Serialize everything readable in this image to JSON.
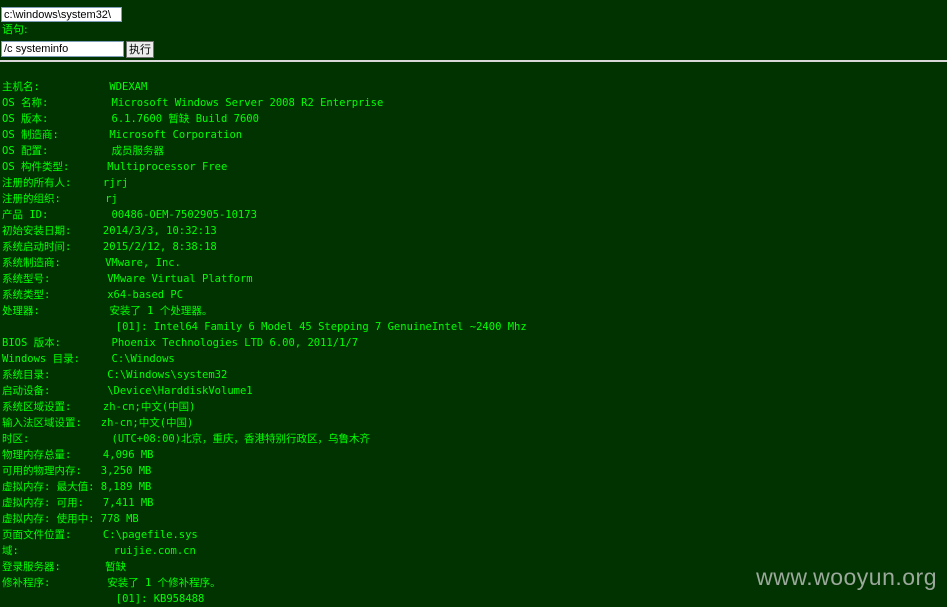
{
  "form": {
    "path_value": "c:\\windows\\system32\\",
    "statement_label": "语句:",
    "command_value": "/c systeminfo",
    "execute_label": "执行"
  },
  "output_lines": [
    "主机名:           WDEXAM",
    "OS 名称:          Microsoft Windows Server 2008 R2 Enterprise",
    "OS 版本:          6.1.7600 暂缺 Build 7600",
    "OS 制造商:        Microsoft Corporation",
    "OS 配置:          成员服务器",
    "OS 构件类型:      Multiprocessor Free",
    "注册的所有人:     rjrj",
    "注册的组织:       rj",
    "产品 ID:          00486-OEM-7502905-10173",
    "初始安装日期:     2014/3/3, 10:32:13",
    "系统启动时间:     2015/2/12, 8:38:18",
    "系统制造商:       VMware, Inc.",
    "系统型号:         VMware Virtual Platform",
    "系统类型:         x64-based PC",
    "处理器:           安装了 1 个处理器。",
    "                  [01]: Intel64 Family 6 Model 45 Stepping 7 GenuineIntel ~2400 Mhz",
    "BIOS 版本:        Phoenix Technologies LTD 6.00, 2011/1/7",
    "Windows 目录:     C:\\Windows",
    "系统目录:         C:\\Windows\\system32",
    "启动设备:         \\Device\\HarddiskVolume1",
    "系统区域设置:     zh-cn;中文(中国)",
    "输入法区域设置:   zh-cn;中文(中国)",
    "时区:             (UTC+08:00)北京，重庆，香港特别行政区，乌鲁木齐",
    "物理内存总量:     4,096 MB",
    "可用的物理内存:   3,250 MB",
    "虚拟内存: 最大值: 8,189 MB",
    "虚拟内存: 可用:   7,411 MB",
    "虚拟内存: 使用中: 778 MB",
    "页面文件位置:     C:\\pagefile.sys",
    "域:               ruijie.com.cn",
    "登录服务器:       暂缺",
    "修补程序:         安装了 1 个修补程序。",
    "                  [01]: KB958488"
  ],
  "watermark": "www.wooyun.org",
  "colors": {
    "background": "#003300",
    "text": "#00ff00",
    "divider": "#d8d8d8"
  }
}
